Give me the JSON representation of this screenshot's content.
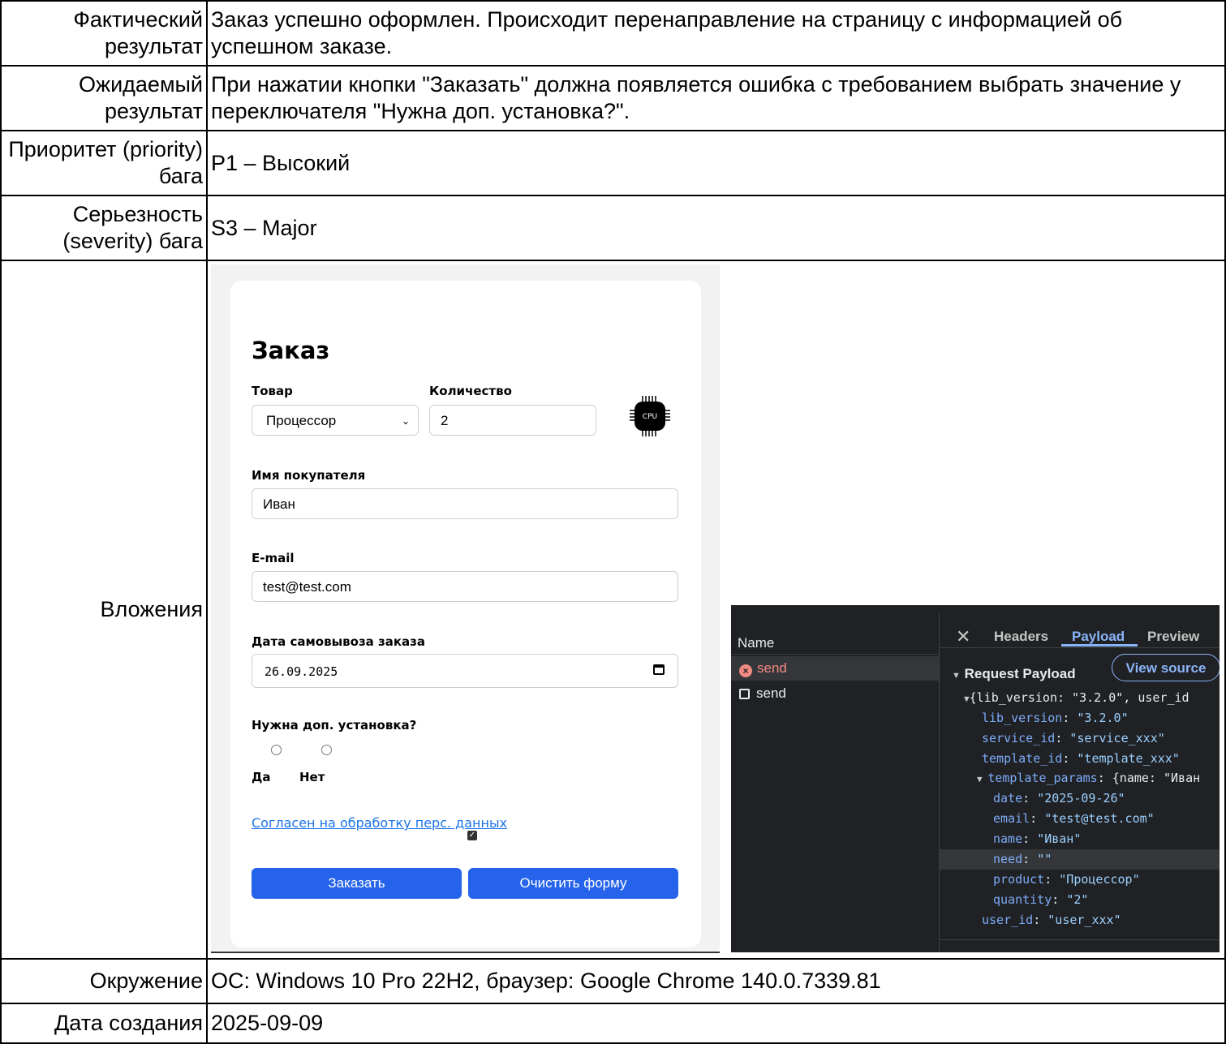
{
  "rows": {
    "actual": {
      "label": "Фактический результат",
      "value": "Заказ успешно оформлен. Происходит перенаправление на страницу с информацией об успешном заказе."
    },
    "expected": {
      "label": "Ожидаемый результат",
      "value": "При нажатии кнопки \"Заказать\" должна появляется ошибка с требованием выбрать значение у переключателя \"Нужна доп. установка?\"."
    },
    "priority": {
      "label": "Приоритет (priority) бага",
      "value": "P1 – Высокий"
    },
    "severity": {
      "label": "Серьезность (severity) бага",
      "value": "S3 – Major"
    },
    "attachments": {
      "label": "Вложения"
    },
    "environment": {
      "label": "Окружение",
      "value": "ОС: Windows 10 Pro 22H2, браузер: Google Chrome 140.0.7339.81"
    },
    "created": {
      "label": "Дата создания",
      "value": "2025-09-09"
    }
  },
  "form": {
    "title": "Заказ",
    "product_label": "Товар",
    "product_value": "Процессор",
    "quantity_label": "Количество",
    "quantity_value": "2",
    "cpu_icon_text": "CPU",
    "buyer_label": "Имя покупателя",
    "buyer_value": "Иван",
    "email_label": "E-mail",
    "email_value": "test@test.com",
    "date_label": "Дата самовывоза заказа",
    "date_value": "26.09.2025",
    "install_label": "Нужна доп. установка?",
    "yes_label": "Да",
    "no_label": "Нет",
    "consent_label": "Согласен на обработку перс. данных",
    "consent_checked": true,
    "order_button": "Заказать",
    "clear_button": "Очистить форму"
  },
  "devtools": {
    "name_header": "Name",
    "requests": [
      {
        "name": "send",
        "status": "error"
      },
      {
        "name": "send",
        "status": "pending"
      }
    ],
    "tabs": [
      "Headers",
      "Payload",
      "Preview"
    ],
    "active_tab": "Payload",
    "section_title": "Request Payload",
    "view_source": "View source",
    "payload_summary": "{lib_version: \"3.2.0\", user_id",
    "payload": {
      "lib_version": {
        "key": "lib_version",
        "value": "\"3.2.0\""
      },
      "service_id": {
        "key": "service_id",
        "value": "\"service_xxx\""
      },
      "template_id": {
        "key": "template_id",
        "value": "\"template_xxx\""
      },
      "template_params": {
        "key": "template_params",
        "summary": "{name: \"Иван"
      },
      "date": {
        "key": "date",
        "value": "\"2025-09-26\""
      },
      "email": {
        "key": "email",
        "value": "\"test@test.com\""
      },
      "name": {
        "key": "name",
        "value": "\"Иван\""
      },
      "need": {
        "key": "need",
        "value": "\"\""
      },
      "product": {
        "key": "product",
        "value": "\"Процессор\""
      },
      "quantity": {
        "key": "quantity",
        "value": "\"2\""
      },
      "user_id": {
        "key": "user_id",
        "value": "\"user_xxx\""
      }
    }
  },
  "colors": {
    "accent": "#2563eb",
    "link": "#1a73e8",
    "devtools_bg": "#202124",
    "devtools_key": "#7cacf8",
    "devtools_string": "#9ad0ff"
  }
}
